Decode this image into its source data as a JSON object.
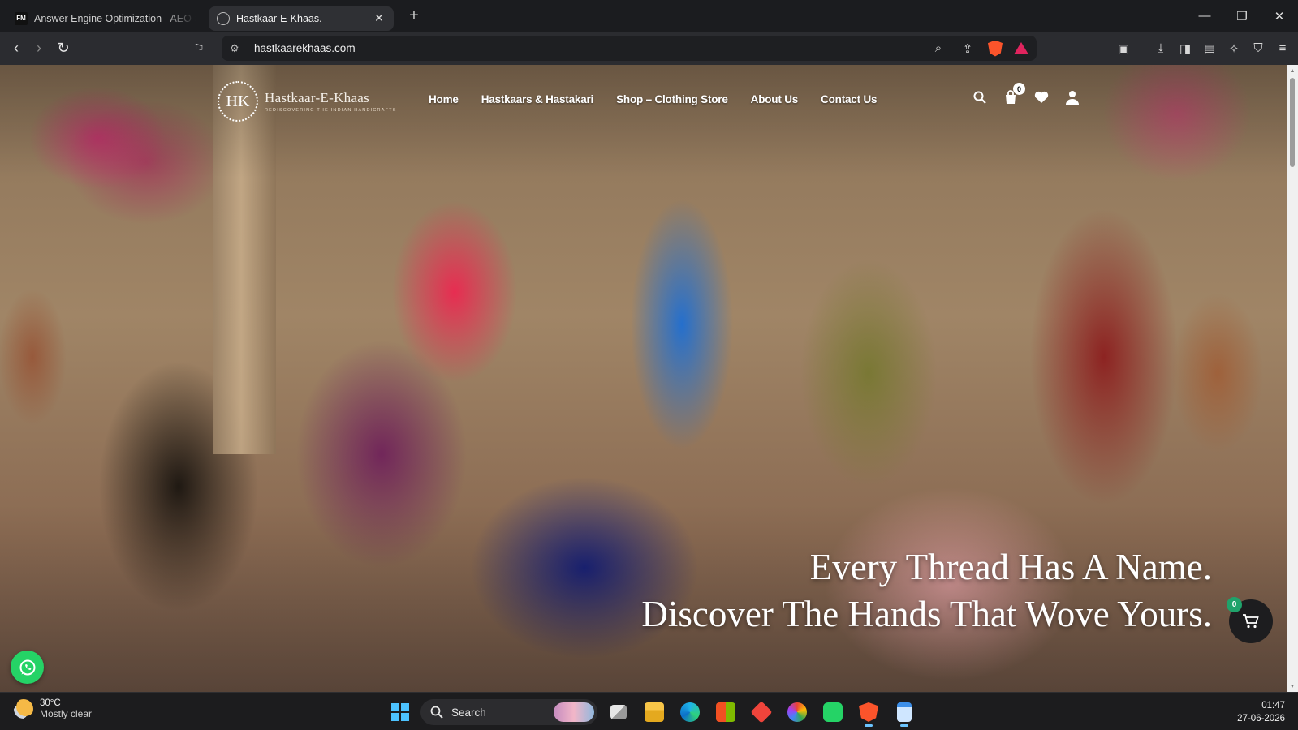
{
  "browser": {
    "tabs": [
      {
        "title": "Answer Engine Optimization - AEO S",
        "favicon": "FM",
        "active": false
      },
      {
        "title": "Hastkaar-E-Khaas.",
        "favicon": "globe-icon",
        "active": true
      }
    ],
    "url": "hastkaarekhaas.com"
  },
  "site": {
    "logo": {
      "monogram": "HK",
      "name": "Hastkaar-E-Khaas",
      "tagline": "REDISCOVERING THE INDIAN HANDICRAFTS"
    },
    "nav": [
      {
        "label": "Home"
      },
      {
        "label": "Hastkaars & Hastakari"
      },
      {
        "label": "Shop – Clothing Store"
      },
      {
        "label": "About Us"
      },
      {
        "label": "Contact Us"
      }
    ],
    "cart_count": "0",
    "hero": {
      "line1": "Every Thread Has A Name.",
      "line2": "Discover The Hands That Wove Yours."
    },
    "floating_cart_count": "0"
  },
  "taskbar": {
    "weather": {
      "temp": "30°C",
      "condition": "Mostly clear"
    },
    "search_label": "Search",
    "time": "01:47",
    "date": "27-06-2026"
  },
  "colors": {
    "accent_whatsapp": "#25d366",
    "cart_badge": "#1fa36b",
    "brave": "#fb542b"
  }
}
